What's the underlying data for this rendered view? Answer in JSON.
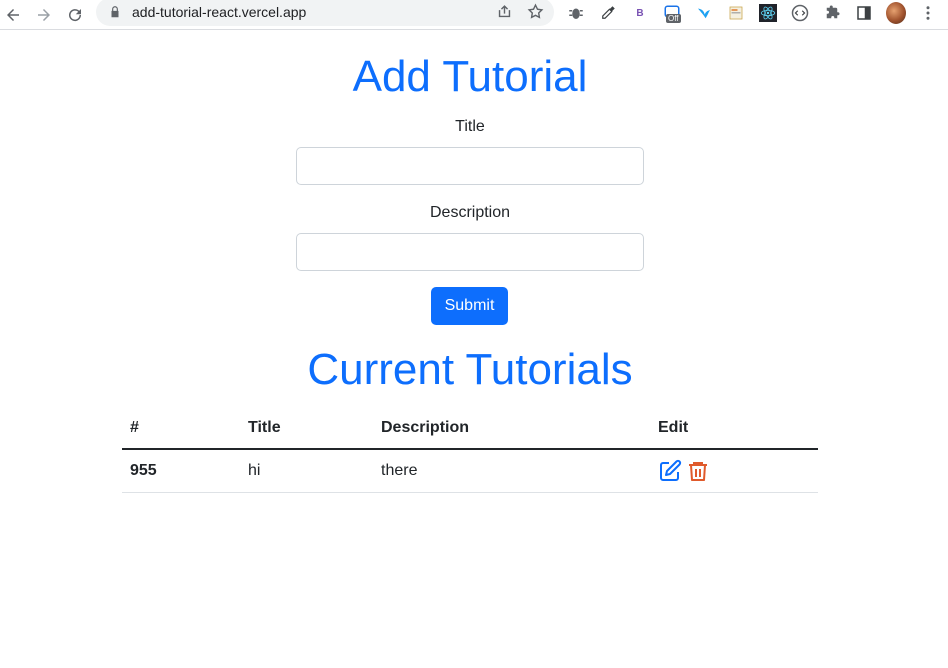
{
  "browser": {
    "url": "add-tutorial-react.vercel.app",
    "extension_badge": "Off",
    "bootstrap_ext_letter": "B"
  },
  "form": {
    "heading": "Add Tutorial",
    "title_label": "Title",
    "title_value": "",
    "description_label": "Description",
    "description_value": "",
    "submit_label": "Submit"
  },
  "list": {
    "heading": "Current Tutorials",
    "columns": [
      "#",
      "Title",
      "Description",
      "Edit"
    ],
    "rows": [
      {
        "id": "955",
        "title": "hi",
        "description": "there"
      }
    ]
  },
  "colors": {
    "primary": "#0d6efd",
    "edit_icon": "#0d6efd",
    "delete_icon": "#e05a2b"
  }
}
